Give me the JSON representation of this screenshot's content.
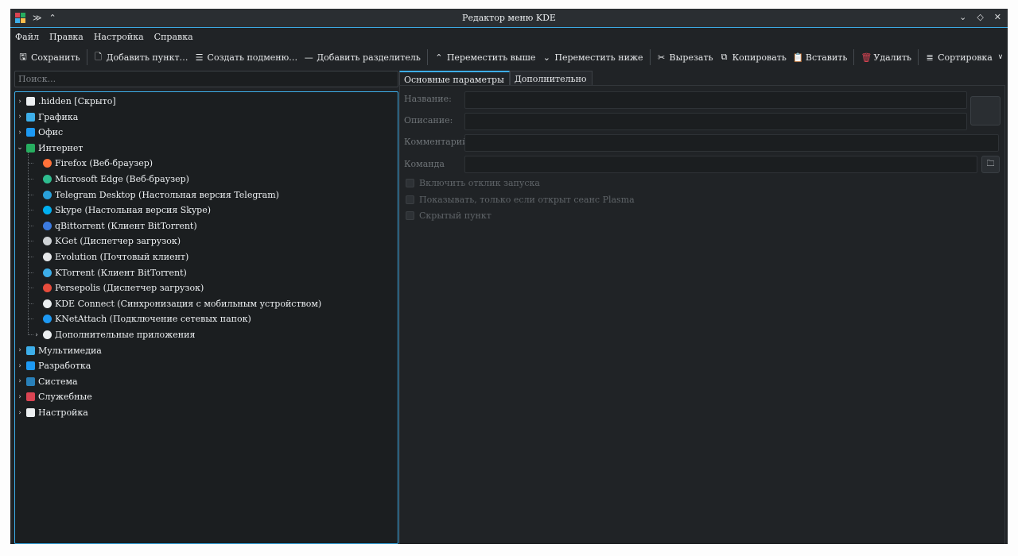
{
  "window": {
    "title": "Редактор меню KDE",
    "left_glyphs": [
      "≫",
      "⌃"
    ],
    "right_glyphs": [
      "⌄",
      "◇",
      "✕"
    ]
  },
  "menubar": [
    "Файл",
    "Правка",
    "Настройка",
    "Справка"
  ],
  "toolbar": {
    "save": "Сохранить",
    "add_item": "Добавить пункт…",
    "create_submenu": "Создать подменю…",
    "add_separator": "Добавить разделитель",
    "move_up": "Переместить выше",
    "move_down": "Переместить ниже",
    "cut": "Вырезать",
    "copy": "Копировать",
    "paste": "Вставить",
    "delete": "Удалить",
    "sort": "Сортировка"
  },
  "search": {
    "placeholder": "Поиск..."
  },
  "tree": [
    {
      "label": ".hidden [Скрыто]",
      "icon": "folder-icon",
      "color": "#eceff1",
      "expanded": false
    },
    {
      "label": "Графика",
      "icon": "graphics-icon",
      "color": "#3daee9",
      "expanded": false
    },
    {
      "label": "Офис",
      "icon": "office-icon",
      "color": "#1d99f3",
      "expanded": false
    },
    {
      "label": "Интернет",
      "icon": "internet-icon",
      "color": "#27ae60",
      "expanded": true,
      "children": [
        {
          "label": "Firefox (Веб-браузер)",
          "icon": "firefox-icon",
          "color": "#ff7139"
        },
        {
          "label": "Microsoft Edge (Веб-браузер)",
          "icon": "edge-icon",
          "color": "#2ebd8f"
        },
        {
          "label": "Telegram Desktop (Настольная версия Telegram)",
          "icon": "telegram-icon",
          "color": "#2aa1da"
        },
        {
          "label": "Skype (Настольная версия Skype)",
          "icon": "skype-icon",
          "color": "#00aff0"
        },
        {
          "label": "qBittorrent (Клиент BitTorrent)",
          "icon": "qbittorrent-icon",
          "color": "#3c7be0"
        },
        {
          "label": "KGet (Диспетчер загрузок)",
          "icon": "kget-icon",
          "color": "#cfd3d6"
        },
        {
          "label": "Evolution (Почтовый клиент)",
          "icon": "evolution-icon",
          "color": "#e6e8ea"
        },
        {
          "label": "KTorrent (Клиент BitTorrent)",
          "icon": "ktorrent-icon",
          "color": "#3daee9"
        },
        {
          "label": "Persepolis (Диспетчер загрузок)",
          "icon": "persepolis-icon",
          "color": "#e74c3c"
        },
        {
          "label": "KDE Connect (Синхронизация с мобильным устройством)",
          "icon": "kdeconnect-icon",
          "color": "#eceff1"
        },
        {
          "label": "KNetAttach (Подключение сетевых папок)",
          "icon": "knetattach-icon",
          "color": "#1d99f3"
        },
        {
          "label": "Дополнительные приложения",
          "icon": "more-apps-icon",
          "color": "#eceff1",
          "expanded": false
        }
      ]
    },
    {
      "label": "Мультимедиа",
      "icon": "multimedia-icon",
      "color": "#3daee9",
      "expanded": false
    },
    {
      "label": "Разработка",
      "icon": "development-icon",
      "color": "#1d99f3",
      "expanded": false
    },
    {
      "label": "Система",
      "icon": "system-icon",
      "color": "#2980b9",
      "expanded": false
    },
    {
      "label": "Служебные",
      "icon": "utilities-icon",
      "color": "#da4453",
      "expanded": false
    },
    {
      "label": "Настройка",
      "icon": "settings-icon",
      "color": "#eceff1",
      "expanded": false
    }
  ],
  "tabs": [
    "Основные параметры",
    "Дополнительно"
  ],
  "form": {
    "name_label": "Название:",
    "description_label": "Описание:",
    "comment_label": "Комментарий:",
    "command_label": "Команда",
    "cb_launch_feedback": "Включить отклик запуска",
    "cb_only_plasma": "Показывать, только если открыт сеанс Plasma",
    "cb_hidden": "Скрытый пункт"
  }
}
